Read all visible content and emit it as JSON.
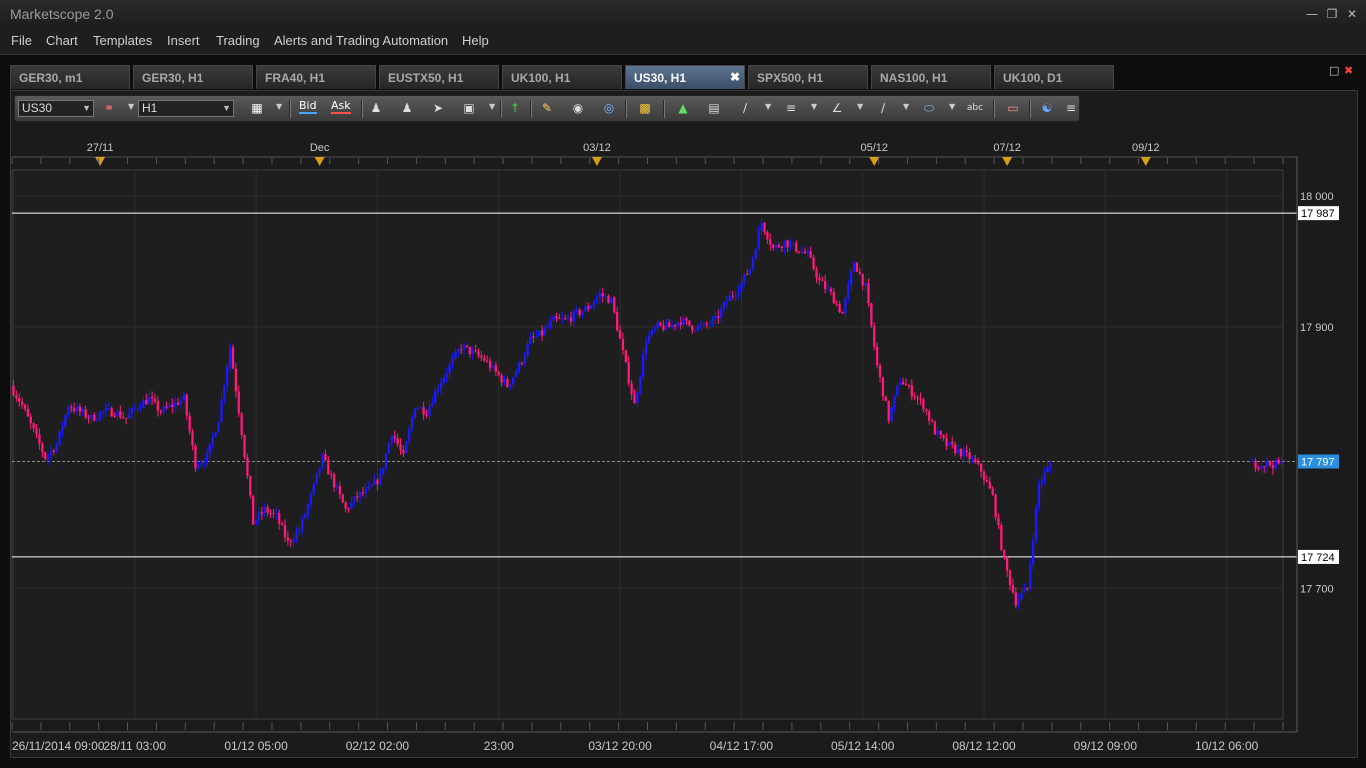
{
  "app": {
    "title": "Marketscope 2.0"
  },
  "menu": [
    "File",
    "Chart",
    "Templates",
    "Insert",
    "Trading",
    "Alerts and Trading Automation",
    "Help"
  ],
  "tabs": [
    {
      "label": "GER30, m1",
      "active": false
    },
    {
      "label": "GER30, H1",
      "active": false
    },
    {
      "label": "FRA40, H1",
      "active": false
    },
    {
      "label": "EUSTX50, H1",
      "active": false
    },
    {
      "label": "UK100, H1",
      "active": false
    },
    {
      "label": "US30, H1",
      "active": true
    },
    {
      "label": "SPX500, H1",
      "active": false
    },
    {
      "label": "NAS100, H1",
      "active": false
    },
    {
      "label": "UK100, D1",
      "active": false
    }
  ],
  "toolbar": {
    "instrument": "US30",
    "timeframe": "H1",
    "bid_label": "Bid",
    "ask_label": "Ask"
  },
  "colors": {
    "bull": "#1a1aff",
    "bear": "#ff1a7a",
    "current_price_bg": "#2b8fe0"
  },
  "chart_data": {
    "type": "candlestick",
    "instrument": "US30",
    "timeframe": "H1",
    "ylim": [
      17600,
      18020
    ],
    "y_ticks": [
      "18 000",
      "17 900",
      "17 700"
    ],
    "y_tick_values": [
      18000,
      17900,
      17700
    ],
    "x_ticks": [
      "26/11/2014 09:00",
      "28/11 03:00",
      "01/12 05:00",
      "02/12 02:00",
      "23:00",
      "03/12 20:00",
      "04/12 17:00",
      "05/12 14:00",
      "08/12 12:00",
      "09/12 09:00",
      "10/12 06:00"
    ],
    "x_tick_index": [
      0,
      42,
      84,
      126,
      168,
      210,
      252,
      294,
      336,
      378,
      420
    ],
    "event_markers": [
      "27/11",
      "Dec",
      "03/12",
      "05/12",
      "07/12",
      "09/12"
    ],
    "event_marker_index": [
      30,
      106,
      202,
      298,
      344,
      392
    ],
    "horizontal_lines": [
      17987,
      17724
    ],
    "horizontal_line_labels": [
      "17 987",
      "17 724"
    ],
    "current_price": 17797,
    "current_price_label": "17 797",
    "num_candles": 440,
    "close_path_index": [
      0,
      4,
      8,
      12,
      16,
      20,
      24,
      28,
      32,
      36,
      40,
      44,
      48,
      52,
      56,
      60,
      64,
      68,
      72,
      76,
      80,
      84,
      88,
      92,
      96,
      100,
      104,
      108,
      112,
      116,
      120,
      124,
      128,
      132,
      136,
      140,
      144,
      148,
      152,
      156,
      160,
      164,
      168,
      172,
      176,
      180,
      184,
      188,
      192,
      196,
      200,
      204,
      208,
      212,
      216,
      220,
      224,
      228,
      232,
      236,
      240,
      244,
      248,
      252,
      256,
      260,
      264,
      268,
      272,
      276,
      280,
      284,
      288,
      292,
      296,
      300,
      304,
      308,
      312,
      316,
      320,
      324,
      328,
      332,
      336,
      340,
      344,
      348,
      352,
      356,
      360,
      364,
      368,
      372,
      376,
      380,
      384,
      388,
      392,
      396,
      400,
      404,
      408,
      412,
      416,
      420,
      424,
      428
    ],
    "close_path": [
      17855,
      17840,
      17820,
      17800,
      17810,
      17840,
      17835,
      17830,
      17835,
      17835,
      17830,
      17840,
      17845,
      17835,
      17840,
      17845,
      17795,
      17800,
      17830,
      17885,
      17820,
      17750,
      17760,
      17755,
      17735,
      17745,
      17770,
      17800,
      17780,
      17760,
      17770,
      17775,
      17785,
      17820,
      17800,
      17840,
      17835,
      17855,
      17870,
      17885,
      17880,
      17875,
      17865,
      17855,
      17870,
      17890,
      17895,
      17905,
      17905,
      17910,
      17915,
      17925,
      17920,
      17880,
      17840,
      17890,
      17900,
      17900,
      17905,
      17900,
      17900,
      17905,
      17920,
      17930,
      17945,
      17980,
      17960,
      17965,
      17960,
      17955,
      17935,
      17925,
      17910,
      17950,
      17930,
      17870,
      17830,
      17860,
      17850,
      17840,
      17820,
      17810,
      17805,
      17800,
      17790,
      17770,
      17720,
      17690,
      17700,
      17780,
      17795
    ]
  }
}
